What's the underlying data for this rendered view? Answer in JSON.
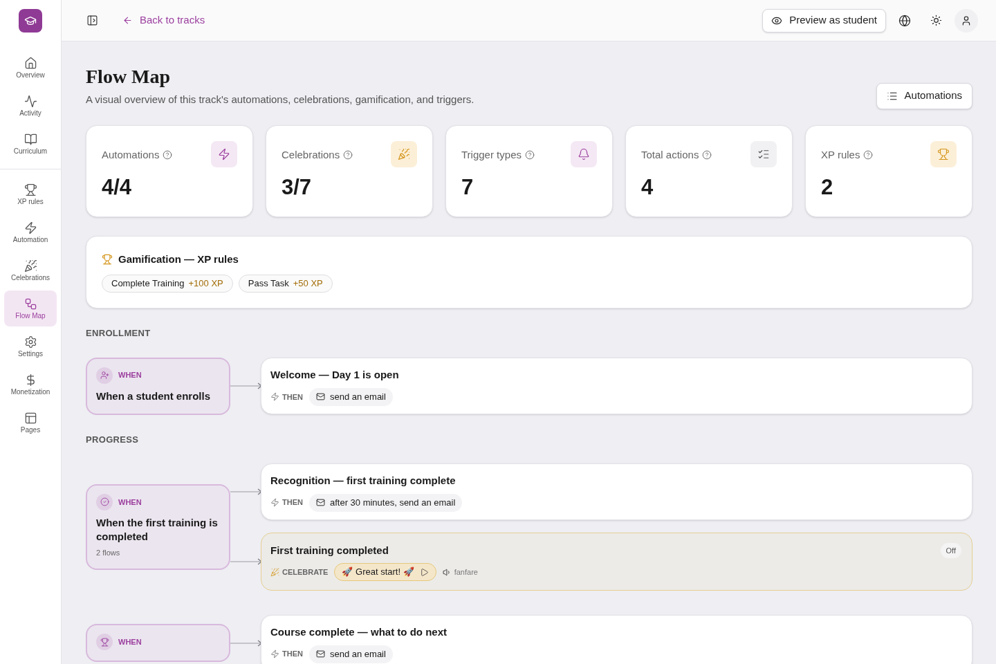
{
  "topbar": {
    "back_link": "Back to tracks",
    "preview_button": "Preview as student"
  },
  "sidebar": {
    "groups": [
      {
        "items": [
          {
            "kind": "home",
            "label": "Overview",
            "selected": false
          },
          {
            "kind": "activity",
            "label": "Activity",
            "selected": false
          },
          {
            "kind": "book",
            "label": "Curriculum",
            "selected": false
          }
        ]
      },
      {
        "items": [
          {
            "kind": "trophy",
            "label": "XP rules",
            "selected": false
          },
          {
            "kind": "zap",
            "label": "Automation",
            "selected": false
          },
          {
            "kind": "party",
            "label": "Celebrations",
            "selected": false
          },
          {
            "kind": "flow",
            "label": "Flow Map",
            "selected": true
          },
          {
            "kind": "settings",
            "label": "Settings",
            "selected": false
          },
          {
            "kind": "dollar",
            "label": "Monetization",
            "selected": false
          },
          {
            "kind": "pages",
            "label": "Pages",
            "selected": false
          }
        ]
      }
    ]
  },
  "header": {
    "title": "Flow Map",
    "subtitle": "A visual overview of this track's automations, celebrations, gamification, and triggers.",
    "button": "Automations"
  },
  "stats": [
    {
      "kind": "zap",
      "label": "Automations",
      "value": "4/4"
    },
    {
      "kind": "party",
      "label": "Celebrations",
      "value": "3/7"
    },
    {
      "kind": "bell",
      "label": "Trigger types",
      "value": "7"
    },
    {
      "kind": "checklist",
      "label": "Total actions",
      "value": "4"
    },
    {
      "kind": "trophy",
      "label": "XP rules",
      "value": "2"
    }
  ],
  "gamification": {
    "title": "Gamification — XP rules",
    "rules": [
      {
        "label": "Complete Training",
        "points": "+100 XP"
      },
      {
        "label": "Pass Task",
        "points": "+50 XP"
      }
    ]
  },
  "sections": [
    {
      "title": "ENROLLMENT",
      "flows": [
        {
          "trigger": {
            "kind": "enroll",
            "label": "WHEN",
            "title": "When a student enrolls"
          },
          "actions": [
            {
              "kind": "email",
              "title": "Welcome — Day 1 is open",
              "step": "THEN",
              "detail": "send an email"
            }
          ]
        }
      ]
    },
    {
      "title": "PROGRESS",
      "flows": [
        {
          "trigger": {
            "kind": "complete",
            "label": "WHEN",
            "title": "When the first training is completed",
            "note": "2 flows"
          },
          "actions": [
            {
              "kind": "email",
              "title": "Recognition — first training complete",
              "step": "THEN",
              "detail": "after 30 minutes, send an email"
            },
            {
              "kind": "celebrate",
              "title": "First training completed",
              "step": "CELEBRATE",
              "detail": "🚀 Great start! 🚀",
              "sound": "fanfare",
              "badge": "Off"
            }
          ]
        },
        {
          "trigger": {
            "kind": "award",
            "label": "WHEN"
          },
          "actions": [
            {
              "kind": "email",
              "title": "Course complete — what to do next",
              "step": "THEN",
              "detail": "send an email"
            }
          ]
        }
      ]
    }
  ]
}
